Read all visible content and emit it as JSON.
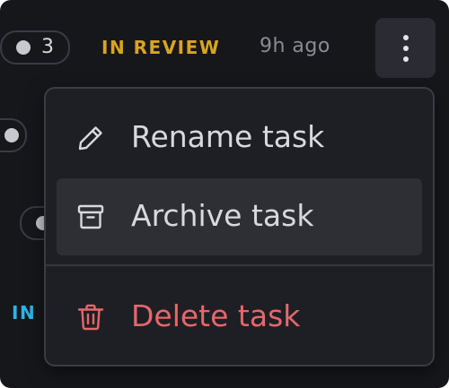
{
  "task_row": {
    "subtask_count": "3",
    "status": "IN REVIEW",
    "time_ago": "9h  ago"
  },
  "other_row": {
    "status": "IN"
  },
  "menu": {
    "items": [
      {
        "label": "Rename task",
        "icon": "pencil-icon",
        "color": "#d8d9de"
      },
      {
        "label": "Archive task",
        "icon": "archive-box-icon",
        "color": "#d8d9de",
        "hovered": true
      },
      {
        "label": "Delete task",
        "icon": "trash-icon",
        "color": "#e5676b"
      }
    ]
  },
  "colors": {
    "status_review": "#d9a420",
    "status_in": "#2bb5e8",
    "danger": "#e5676b",
    "background": "#16171b",
    "menu_background": "#1e1f24"
  }
}
